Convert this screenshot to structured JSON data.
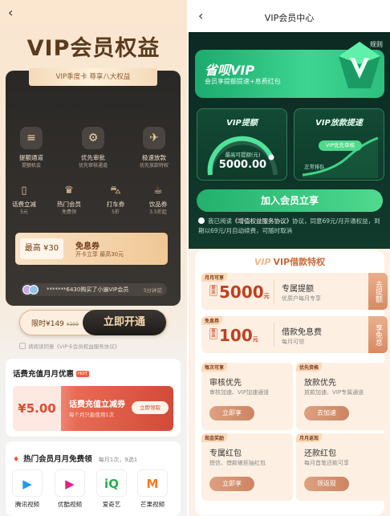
{
  "left": {
    "back": "‹",
    "title": "VIP会员权益",
    "ribbon": "VIP季度卡 尊享八大权益",
    "benefits": [
      {
        "title": "提额通道",
        "sub": "提额机会",
        "icon": "credit-line-icon",
        "glyph": "≡"
      },
      {
        "title": "优先审批",
        "sub": "优先审核通道",
        "icon": "approval-icon",
        "glyph": "⚙"
      },
      {
        "title": "极速放款",
        "sub": "优先放款特权",
        "icon": "fast-loan-icon",
        "glyph": "✈"
      }
    ],
    "small_benefits": [
      {
        "title": "话费立减",
        "sub": "5元",
        "icon": "phone-bill-icon",
        "glyph": "▯"
      },
      {
        "title": "热门会员",
        "sub": "免费领",
        "icon": "crown-icon",
        "glyph": "♛"
      },
      {
        "title": "打车券",
        "sub": "5折",
        "icon": "car-icon",
        "glyph": "⛍"
      },
      {
        "title": "饮品券",
        "sub": "3.5折起",
        "icon": "drink-icon",
        "glyph": "☕"
      }
    ],
    "coupon": {
      "amount": "最高 ¥30",
      "title": "免息券",
      "desc": "开卡立享 最高30元"
    },
    "notice": {
      "text": "*******6430购买了小遍VIP会员",
      "ago": "3分钟前"
    },
    "buy": {
      "price": "限时¥149",
      "original": "¥299",
      "button": "立即开通"
    },
    "agree": "请阅读同意《VIP卡会员权益服务协议》",
    "recharge": {
      "title": "话费充值月月优惠",
      "badge": "HOT",
      "amount": "¥5.00",
      "name": "话费充值立减券",
      "desc": "每个月只能使用1次",
      "button": "立即领取"
    },
    "members": {
      "title": "热门会员月月免费领",
      "desc": "每月1次，9选1",
      "apps": [
        {
          "name": "腾讯视频",
          "icon": "tencent-video-icon",
          "glyph": "▶",
          "color": "#1d9bf0"
        },
        {
          "name": "优酷视频",
          "icon": "youku-icon",
          "glyph": "▶",
          "color": "#e0208f"
        },
        {
          "name": "爱奇艺",
          "icon": "iqiyi-icon",
          "glyph": "iQ",
          "color": "#22b14c"
        },
        {
          "name": "芒果视频",
          "icon": "mango-tv-icon",
          "glyph": "M",
          "color": "#f47b20"
        }
      ]
    }
  },
  "right": {
    "back": "‹",
    "title": "VIP会员中心",
    "rule": "规则",
    "banner": {
      "title": "省呗VIP",
      "desc": "会员享提额提速+息费红包"
    },
    "credit": {
      "title": "VIP提额",
      "label": "最高可提额(元)",
      "value": "5000.00"
    },
    "loan": {
      "title": "VIP放款提速",
      "badge": "VIP优先审核",
      "normal": "正常排队"
    },
    "join": "加入会员立享",
    "terms_pre": "我已阅读",
    "terms_link": "《增值权益服务协议》",
    "terms_post": "协议，同意69元/月开通权益，到期以69元/月自动续费，可随时取消",
    "special": {
      "title": "VIP借款特权",
      "rows": [
        {
          "tag": "月月可享",
          "prefix": "最高",
          "amount": "5000",
          "unit": "元",
          "title": "专属提额",
          "desc": "优质户每月专享",
          "button": "去提额"
        },
        {
          "tag": "免息券",
          "prefix": "最高",
          "amount": "100",
          "unit": "元",
          "title": "借款免息费",
          "desc": "每月可领",
          "button": "享免息"
        }
      ],
      "cards": [
        {
          "tag": "每次可享",
          "title": "审核优先",
          "desc": "审核加速、VIP加速通道",
          "button": "立即享"
        },
        {
          "tag": "优先资格",
          "title": "放款优先",
          "desc": "放款加速、VIP专属通道",
          "button": "去加速"
        },
        {
          "tag": "现金奖励",
          "title": "专属红包",
          "desc": "授信、借款被拒抽红包",
          "button": "立即享"
        },
        {
          "tag": "月月返现",
          "title": "还款红包",
          "desc": "每月首笔还款可享",
          "button": "领返现"
        }
      ]
    }
  }
}
